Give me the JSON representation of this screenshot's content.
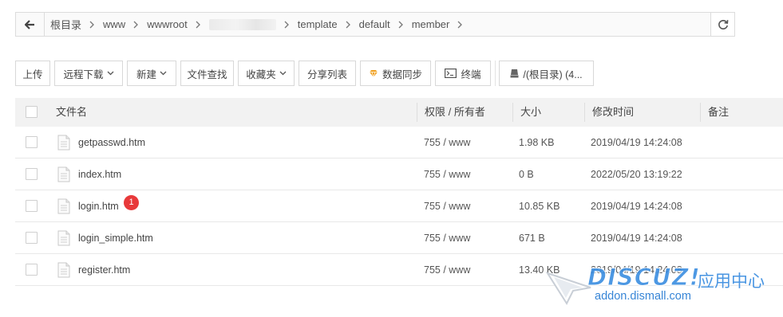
{
  "pathbar": {
    "crumbs": [
      {
        "label": "根目录"
      },
      {
        "label": "www"
      },
      {
        "label": "wwwroot"
      },
      {
        "label": "site",
        "blurred": true
      },
      {
        "label": "template"
      },
      {
        "label": "default"
      },
      {
        "label": "member"
      }
    ]
  },
  "toolbar": {
    "upload": "上传",
    "remote_download": "远程下载",
    "new": "新建",
    "file_search": "文件查找",
    "favorites": "收藏夹",
    "share_list": "分享列表",
    "data_sync": "数据同步",
    "terminal": "终端",
    "disk": "/(根目录) (4..."
  },
  "table": {
    "headers": {
      "name": "文件名",
      "perm": "权限 / 所有者",
      "size": "大小",
      "mtime": "修改时间",
      "note": "备注"
    },
    "rows": [
      {
        "name": "getpasswd.htm",
        "perm": "755 / www",
        "size": "1.98 KB",
        "mtime": "2019/04/19 14:24:08",
        "note": ""
      },
      {
        "name": "index.htm",
        "perm": "755 / www",
        "size": "0 B",
        "mtime": "2022/05/20 13:19:22",
        "note": ""
      },
      {
        "name": "login.htm",
        "perm": "755 / www",
        "size": "10.85 KB",
        "mtime": "2019/04/19 14:24:08",
        "note": ""
      },
      {
        "name": "login_simple.htm",
        "perm": "755 / www",
        "size": "671 B",
        "mtime": "2019/04/19 14:24:08",
        "note": ""
      },
      {
        "name": "register.htm",
        "perm": "755 / www",
        "size": "13.40 KB",
        "mtime": "2019/04/19 14:24:08",
        "note": ""
      }
    ]
  },
  "annotation": {
    "badge": "1"
  },
  "watermark": {
    "logo": "DISCUZ!",
    "cn": "应用中心",
    "url": "addon.dismall.com"
  },
  "colors": {
    "badge": "#e8393a",
    "watermark_blue": "#3a8de0",
    "header_bg": "#f2f2f2",
    "border": "#dcdcdc",
    "sync_icon": "#f0a020"
  }
}
